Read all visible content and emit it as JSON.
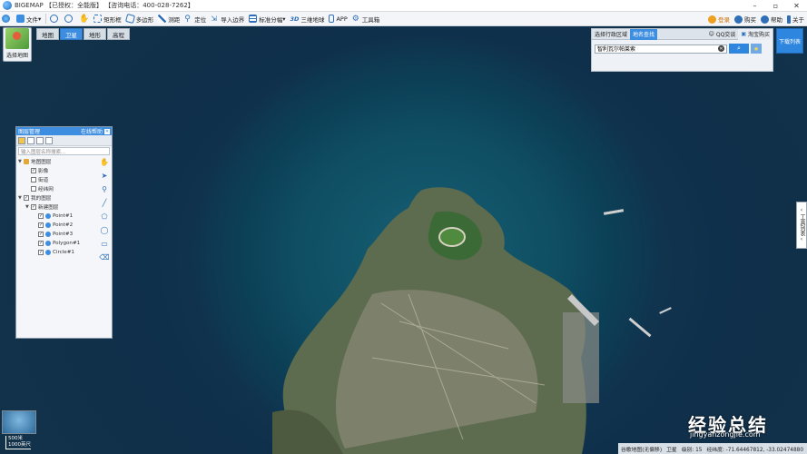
{
  "titlebar": {
    "title": "BIGEMAP 【已授权：全能版】 【咨询电话：400-028-7262】"
  },
  "toolbar": {
    "items": [
      "文件",
      "矩形框",
      "多边形",
      "测距",
      "定位",
      "导入边界",
      "标准分幅",
      "三维地球",
      "APP",
      "工具箱"
    ],
    "right_items": [
      "登录",
      "购买",
      "帮助",
      "关于"
    ]
  },
  "map": {
    "tabs": [
      "地图",
      "卫星",
      "地形",
      "高程"
    ],
    "active_tab": "卫星",
    "map_select_label": "选择地图",
    "download_list_label": "下载列表",
    "tools_list_label": "工具列表"
  },
  "search": {
    "tabs": [
      "选择行政区域",
      "地名查找",
      "QQ交谈",
      "淘宝购买"
    ],
    "active_tab": "地名查找",
    "value": "智利瓦尔帕莱索"
  },
  "layers": {
    "title": "图层管理",
    "online_label": "在线帮助",
    "search_placeholder": "输入图层名称搜索...",
    "tree": [
      {
        "label": "地图图层",
        "level": 0,
        "checked": null,
        "toggle": "▼"
      },
      {
        "label": "影像",
        "level": 1,
        "checked": true,
        "toggle": ""
      },
      {
        "label": "街道",
        "level": 1,
        "checked": false,
        "toggle": ""
      },
      {
        "label": "经纬网",
        "level": 1,
        "checked": false,
        "toggle": ""
      },
      {
        "label": "我的图层",
        "level": 0,
        "checked": true,
        "toggle": "▼"
      },
      {
        "label": "新建图层",
        "level": 1,
        "checked": true,
        "toggle": "▼"
      },
      {
        "label": "Point#1",
        "level": 2,
        "checked": true,
        "toggle": ""
      },
      {
        "label": "Point#2",
        "level": 2,
        "checked": true,
        "toggle": ""
      },
      {
        "label": "Point#3",
        "level": 2,
        "checked": true,
        "toggle": ""
      },
      {
        "label": "Polygon#1",
        "level": 2,
        "checked": true,
        "toggle": ""
      },
      {
        "label": "Circle#1",
        "level": 2,
        "checked": true,
        "toggle": ""
      }
    ],
    "side_tools": [
      "hand-icon",
      "pointer-icon",
      "marker-icon",
      "line-icon",
      "polygon-icon",
      "circle-icon",
      "rect-icon",
      "eraser-icon"
    ]
  },
  "scale": {
    "primary": "500米",
    "secondary": "1000英尺"
  },
  "status": {
    "source": "谷歌地图(无偏移)",
    "layer": "卫星",
    "zoom": "级别: 15",
    "coords": "经纬度: -71.64467812, -33.02474880"
  },
  "watermark": {
    "text": "经验总结",
    "url": "jingyanzongjie.com"
  }
}
